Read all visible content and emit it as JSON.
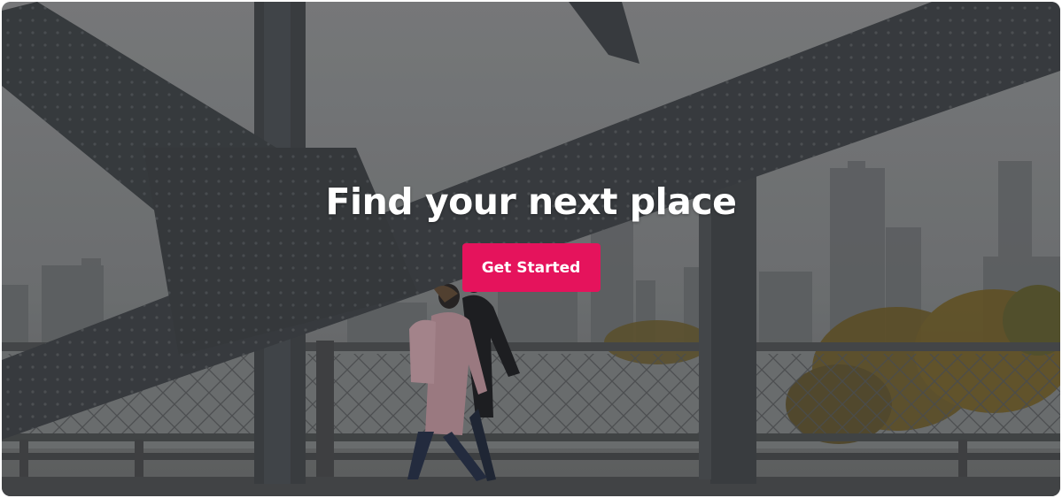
{
  "hero": {
    "title": "Find your next place",
    "cta_label": "Get Started",
    "background_image": "bridge-walkers-photo",
    "colors": {
      "cta": "#e5135c",
      "title": "#ffffff"
    }
  }
}
